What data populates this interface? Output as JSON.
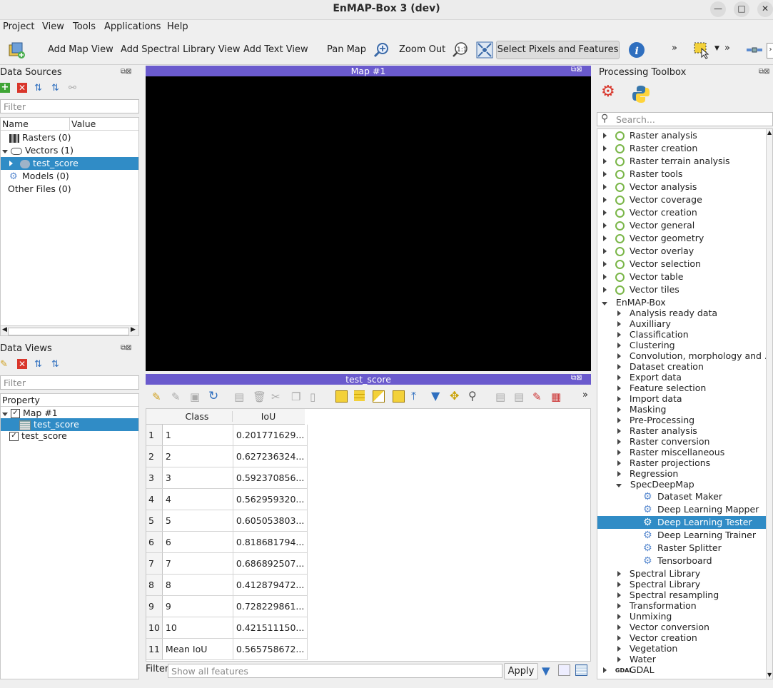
{
  "window": {
    "title": "EnMAP-Box 3 (dev)"
  },
  "menu": [
    "Project",
    "View",
    "Tools",
    "Applications",
    "Help"
  ],
  "toolbar": {
    "add_map_view": "Add Map View",
    "add_spectral_library_view": "Add Spectral Library View",
    "add_text_view": "Add Text View",
    "pan_map": "Pan Map",
    "zoom_out": "Zoom Out",
    "select_pixels": "Select Pixels and Features"
  },
  "data_sources": {
    "title": "Data Sources",
    "filter_placeholder": "Filter",
    "col_name": "Name",
    "col_value": "Value",
    "items": [
      "Rasters (0)",
      "Vectors (1)",
      "test_score",
      "Models (0)",
      "Other Files (0)"
    ]
  },
  "data_views": {
    "title": "Data Views",
    "filter_placeholder": "Filter",
    "col_property": "Property",
    "items": [
      "Map #1",
      "test_score",
      "test_score"
    ]
  },
  "map": {
    "title": "Map #1"
  },
  "attribute_table": {
    "title": "test_score",
    "columns": [
      "Class",
      "IoU"
    ],
    "rows": [
      [
        "1",
        "1",
        "0.201771629..."
      ],
      [
        "2",
        "2",
        "0.627236324..."
      ],
      [
        "3",
        "3",
        "0.592370856..."
      ],
      [
        "4",
        "4",
        "0.562959320..."
      ],
      [
        "5",
        "5",
        "0.605053803..."
      ],
      [
        "6",
        "6",
        "0.818681794..."
      ],
      [
        "7",
        "7",
        "0.686892507..."
      ],
      [
        "8",
        "8",
        "0.412879472..."
      ],
      [
        "9",
        "9",
        "0.728229861..."
      ],
      [
        "10",
        "10",
        "0.421511150..."
      ],
      [
        "11",
        "Mean IoU",
        "0.565758672..."
      ]
    ],
    "filter_label": "Filter",
    "filter_placeholder": "Show all features",
    "apply_label": "Apply"
  },
  "processing": {
    "title": "Processing Toolbox",
    "search_placeholder": "Search...",
    "qgis_groups": [
      "Raster analysis",
      "Raster creation",
      "Raster terrain analysis",
      "Raster tools",
      "Vector analysis",
      "Vector coverage",
      "Vector creation",
      "Vector general",
      "Vector geometry",
      "Vector overlay",
      "Vector selection",
      "Vector table",
      "Vector tiles"
    ],
    "enmap_box": "EnMAP-Box",
    "enmap_groups_before": [
      "Analysis ready data",
      "Auxilliary",
      "Classification",
      "Clustering",
      "Convolution, morphology and ...",
      "Dataset creation",
      "Export data",
      "Feature selection",
      "Import data",
      "Masking",
      "Pre-Processing",
      "Raster analysis",
      "Raster conversion",
      "Raster miscellaneous",
      "Raster projections",
      "Regression"
    ],
    "specdeepmap": "SpecDeepMap",
    "specdeepmap_tools": [
      "Dataset Maker",
      "Deep Learning Mapper",
      "Deep Learning Tester",
      "Deep Learning Trainer",
      "Raster Splitter",
      "Tensorboard"
    ],
    "selected_tool": "Deep Learning Tester",
    "enmap_groups_after": [
      "Spectral Library",
      "Spectral Library",
      "Spectral resampling",
      "Transformation",
      "Unmixing",
      "Vector conversion",
      "Vector creation",
      "Vegetation",
      "Water"
    ],
    "gdal": "GDAL"
  }
}
